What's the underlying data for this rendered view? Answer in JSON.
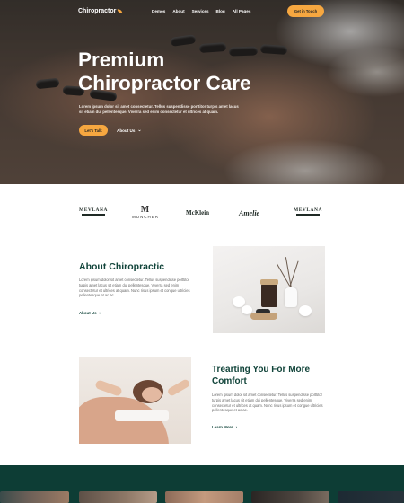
{
  "nav": {
    "logo": "Chiropractor",
    "items": [
      "Demos",
      "About",
      "Services",
      "Blog",
      "All Pages"
    ],
    "cta": "Get in Touch"
  },
  "hero": {
    "title_line1": "Premium",
    "title_line2": "Chiropractor Care",
    "text": "Lorem ipsum dolor sit amet consectetur. Tellus suspendisse porttitor turpis amet lacus sit etiam dui pellentesque. Viverra sed enim consectetur et ultrices at quam.",
    "btn_talk": "Let's Talk",
    "btn_about": "About Us"
  },
  "brands": {
    "b1": "MEVLANA",
    "b2_mark": "M",
    "b2": "MUNCHER",
    "b3": "McKlein",
    "b4": "Amelie",
    "b5": "MEVLANA"
  },
  "about": {
    "title": "About Chiropractic",
    "text": "Lorem ipsum dolor sit amet consectetur. Tellus suspendisse porttitor turpis amet lacus sit etiam dui pellentesque. Viverra sed enim consectetur et ultrices at quam. Nunc risus ipsum et congue ultricies pellentesque et ac ac.",
    "link": "About Us"
  },
  "comfort": {
    "title": "Trearting You For More Comfort",
    "text": "Lorem ipsum dolor sit amet consectetur. Tellus suspendisse porttitor turpis amet lacus sit etiam dui pellentesque. Viverra sed enim consectetur et ultrices at quam. Nunc risus ipsum et congue ultricies pellentesque et ac ac.",
    "link": "Learn More"
  },
  "icons": {
    "logo_leaf": "leaf-icon",
    "chevron": "chevron-down-icon",
    "arrow": "arrow-right-icon"
  },
  "colors": {
    "accent": "#f6a740",
    "primary": "#11443a",
    "band": "#0d3d35"
  }
}
